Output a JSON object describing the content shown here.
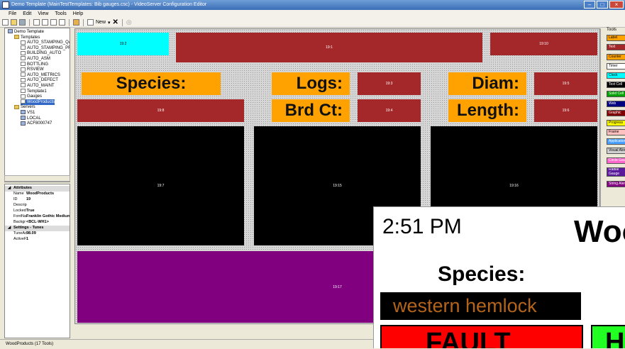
{
  "window": {
    "title": "Demo Template (MainTestTemplates: Bib gauges.csc) - VideoServer Configuration Editor",
    "controls": [
      "–",
      "□",
      "×"
    ]
  },
  "menu": [
    "File",
    "Edit",
    "View",
    "Tools",
    "Help"
  ],
  "toolbar": {
    "new_label": "New"
  },
  "tree": [
    {
      "label": "Demo Template",
      "level": 0,
      "icon": "pc-icon"
    },
    {
      "label": "Templates",
      "level": 1,
      "icon": "folder-icon"
    },
    {
      "label": "AUTO_STAMPING_QA",
      "level": 2,
      "icon": "file-icon"
    },
    {
      "label": "AUTO_STAMPING_PRO",
      "level": 2,
      "icon": "file-icon"
    },
    {
      "label": "BUILDING_AUTO",
      "level": 2,
      "icon": "file-icon"
    },
    {
      "label": "AUTO_ASM",
      "level": 2,
      "icon": "file-icon"
    },
    {
      "label": "BOTTLING",
      "level": 2,
      "icon": "file-icon"
    },
    {
      "label": "RSVIEW",
      "level": 2,
      "icon": "file-icon"
    },
    {
      "label": "AUTO_METRICS",
      "level": 2,
      "icon": "file-icon"
    },
    {
      "label": "AUTO_DEFECT",
      "level": 2,
      "icon": "file-icon"
    },
    {
      "label": "AUTO_MAINT",
      "level": 2,
      "icon": "file-icon"
    },
    {
      "label": "Template1",
      "level": 2,
      "icon": "file-icon"
    },
    {
      "label": "Gauges",
      "level": 2,
      "icon": "file-icon"
    },
    {
      "label": "WoodProducts",
      "level": 2,
      "icon": "file-icon",
      "selected": true
    },
    {
      "label": "Servers",
      "level": 1,
      "icon": "folder-icon"
    },
    {
      "label": "VS1",
      "level": 2,
      "icon": "pc-icon"
    },
    {
      "label": "LOCAL",
      "level": 2,
      "icon": "pc-icon"
    },
    {
      "label": "ACF8000747",
      "level": 2,
      "icon": "pc-icon"
    }
  ],
  "properties": [
    {
      "category": "Attributes"
    },
    {
      "key": "Name",
      "value": "WoodProducts"
    },
    {
      "key": "ID",
      "value": "19"
    },
    {
      "key": "Descrip",
      "value": ""
    },
    {
      "key": "Locked",
      "value": "True"
    },
    {
      "key": "FontNa",
      "value": "Franklin Gothic Medium"
    },
    {
      "key": "Backgr",
      "value": "<BCL-WH1>"
    },
    {
      "category": "Settings - Tunes"
    },
    {
      "key": "TuneAc",
      "value": "98.09"
    },
    {
      "key": "ActiveF",
      "value": "1"
    }
  ],
  "canvas": {
    "widgets": [
      {
        "id": "19:2",
        "color": "#00ffff",
        "text_color": "#000000"
      },
      {
        "id": "19:1",
        "color": "#a4282a",
        "text_color": "#ffffff"
      },
      {
        "id": "19:10",
        "color": "#a4282a",
        "text_color": "#ffffff"
      },
      {
        "id": "19:3",
        "color": "#a4282a",
        "text_color": "#ffffff"
      },
      {
        "id": "19:5",
        "color": "#a4282a",
        "text_color": "#ffffff"
      },
      {
        "id": "19:8",
        "color": "#a4282a",
        "text_color": "#ffffff"
      },
      {
        "id": "19:4",
        "color": "#a4282a",
        "text_color": "#ffffff"
      },
      {
        "id": "19:6",
        "color": "#a4282a",
        "text_color": "#ffffff"
      },
      {
        "id": "19:7",
        "color": "#000000",
        "text_color": "#ffffff"
      },
      {
        "id": "19:15",
        "color": "#000000",
        "text_color": "#ffffff"
      },
      {
        "id": "19:16",
        "color": "#000000",
        "text_color": "#ffffff"
      },
      {
        "id": "19:17",
        "color": "#800080",
        "text_color": "#ffffff"
      }
    ],
    "labels": {
      "species": "Species:",
      "logs": "Logs:",
      "diam": "Diam:",
      "brd_ct": "Brd Ct:",
      "length": "Length:"
    }
  },
  "tools": {
    "title": "Tools",
    "items": [
      {
        "label": "Label",
        "color": "#ffa200",
        "text": "#000"
      },
      {
        "label": "Text",
        "color": "#a4282a",
        "text": "#fff"
      },
      {
        "label": "Counter",
        "color": "#ffa200",
        "text": "#000"
      },
      {
        "label": "Timer",
        "color": "#ffffff",
        "text": "#000"
      },
      {
        "label": "Clock",
        "color": "#00ffff",
        "text": "#000"
      },
      {
        "label": "Text Cell",
        "color": "#000000",
        "text": "#fff"
      },
      {
        "label": "Solid Cell",
        "color": "#00a000",
        "text": "#fff"
      },
      {
        "label": "Web",
        "color": "#000080",
        "text": "#fff"
      },
      {
        "label": "Graphic",
        "color": "#800000",
        "text": "#fff"
      },
      {
        "label": "Progress",
        "color": "#ffff00",
        "text": "#000"
      },
      {
        "label": "Frame",
        "color": "#ffc0c0",
        "text": "#000"
      },
      {
        "label": "Application",
        "color": "#4aa0ff",
        "text": "#fff"
      },
      {
        "label": "Visual Alert",
        "color": "#d0d0d0",
        "text": "#000"
      },
      {
        "label": "Circle Gauge",
        "color": "#ff66cc",
        "text": "#fff"
      },
      {
        "label": "Radial Gauge",
        "color": "#5a1a9a",
        "text": "#fff"
      },
      {
        "label": "String Alert",
        "color": "#800080",
        "text": "#fff"
      }
    ]
  },
  "status": {
    "text": "WoodProducts (17 Tools)"
  },
  "preview": {
    "time": "2:51 PM",
    "title": "Woo",
    "species_label": "Species:",
    "species_value": "western hemlock",
    "fault": "FAULT",
    "ok_partial": "H"
  }
}
